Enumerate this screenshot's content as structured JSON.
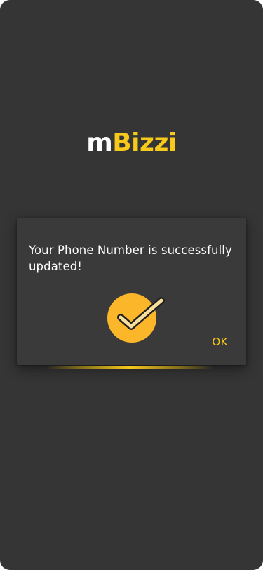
{
  "app": {
    "logo_prefix": "m",
    "logo_main": "Bizzi"
  },
  "dialog": {
    "message": "Your Phone Number is successfully updated!",
    "ok_label": "OK",
    "icon": "check-badge-icon"
  },
  "colors": {
    "background": "#353535",
    "dialog": "#3a3a3a",
    "accent": "#f7c91c",
    "icon_fill": "#fbb62a",
    "check_stroke": "#f8df9c",
    "text": "#ffffff"
  }
}
